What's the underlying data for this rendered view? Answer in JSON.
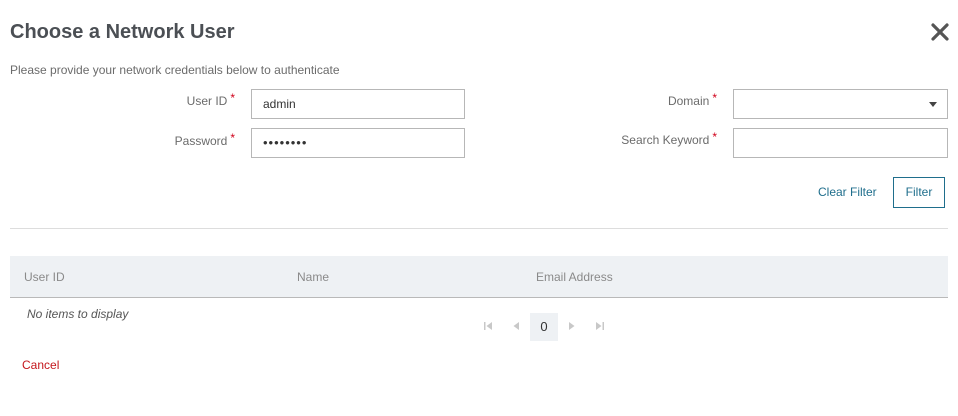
{
  "dialog": {
    "title": "Choose a Network User",
    "subtitle": "Please provide your network credentials below to authenticate"
  },
  "form": {
    "user_id": {
      "label": "User ID",
      "required_mark": "*",
      "value": "admin"
    },
    "password": {
      "label": "Password",
      "required_mark": "*",
      "value": "••••••••"
    },
    "domain": {
      "label": "Domain",
      "required_mark": "*",
      "value": ""
    },
    "search_keyword": {
      "label": "Search Keyword",
      "required_mark": "*",
      "value": ""
    }
  },
  "actions": {
    "clear_filter": "Clear Filter",
    "filter": "Filter",
    "cancel": "Cancel"
  },
  "table": {
    "columns": [
      "User ID",
      "Name",
      "Email Address"
    ],
    "empty_message": "No items to display"
  },
  "pager": {
    "current_page": "0"
  },
  "colors": {
    "accent": "#1f6e8c",
    "required": "#d0021b",
    "cancel": "#c4161c",
    "header_bg": "#eef1f4"
  },
  "icons": [
    "close-icon",
    "first-page-icon",
    "prev-page-icon",
    "next-page-icon",
    "last-page-icon",
    "dropdown-arrow-icon"
  ]
}
